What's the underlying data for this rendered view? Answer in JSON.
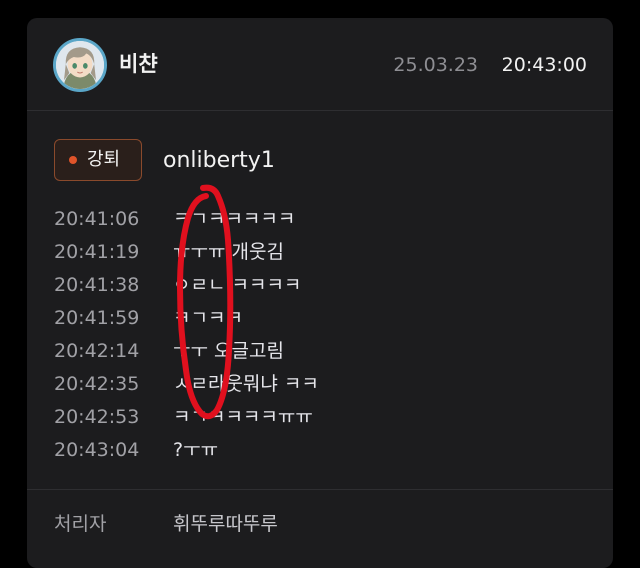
{
  "header": {
    "username": "비챤",
    "date": "25.03.23",
    "time": "20:43:00",
    "avatar_icon": "anime-girl-avatar-icon"
  },
  "action": {
    "badge_label": "강퇴",
    "badge_color": "#e0542a",
    "target_user": "onliberty1"
  },
  "log": [
    {
      "time": "20:41:06",
      "message": "ㅋㄱㅋㅋㅋㅋㅋ"
    },
    {
      "time": "20:41:19",
      "message": "ㅠㅜㅠ 개웃김"
    },
    {
      "time": "20:41:38",
      "message": "ㅇㄹㄴ ㅋㅋㅋㅋ"
    },
    {
      "time": "20:41:59",
      "message": "ㅋㄱㅋㅋ"
    },
    {
      "time": "20:42:14",
      "message": "ㅜㅜ 오글고림"
    },
    {
      "time": "20:42:35",
      "message": "ㅅㄹ라웃뭐냐 ㅋㅋ"
    },
    {
      "time": "20:42:53",
      "message": "ㅋㄱㅋㅋㅋㅋㅠㅠ"
    },
    {
      "time": "20:43:04",
      "message": "?ㅜㅠ"
    }
  ],
  "footer": {
    "label": "처리자",
    "value": "휘뚜루따뚜루"
  },
  "annotation_color": "#e0101e"
}
